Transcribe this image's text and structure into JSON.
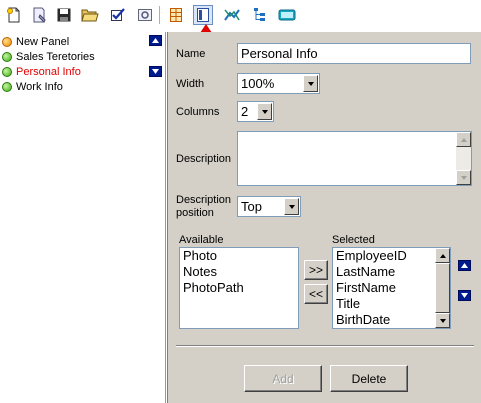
{
  "toolbar": {
    "buttons": [
      {
        "icon": "new-document-icon"
      },
      {
        "icon": "properties-icon"
      },
      {
        "icon": "save-icon"
      },
      {
        "icon": "open-folder-icon"
      },
      {
        "icon": "check-icon"
      },
      {
        "icon": "preview-icon"
      },
      {
        "icon": "table-layout-icon"
      },
      {
        "icon": "panel-icon",
        "active": true
      },
      {
        "icon": "connector-icon"
      },
      {
        "icon": "tree-icon"
      },
      {
        "icon": "keyboard-icon"
      }
    ],
    "highlight_color": "#e00000"
  },
  "tree": {
    "items": [
      {
        "label": "New Panel",
        "status": "orange"
      },
      {
        "label": "Sales Teretories",
        "status": "green"
      },
      {
        "label": "Personal Info",
        "status": "green",
        "selected": true
      },
      {
        "label": "Work Info",
        "status": "green"
      }
    ]
  },
  "form": {
    "name_label": "Name",
    "name_value": "Personal Info",
    "width_label": "Width",
    "width_value": "100%",
    "columns_label": "Columns",
    "columns_value": "2",
    "description_label": "Description",
    "description_value": "",
    "desc_position_label_1": "Description",
    "desc_position_label_2": "position",
    "desc_position_value": "Top",
    "available_label": "Available",
    "available_items": [
      "Photo",
      "Notes",
      "PhotoPath"
    ],
    "selected_label": "Selected",
    "selected_items": [
      "EmployeeID",
      "LastName",
      "FirstName",
      "Title",
      "BirthDate"
    ],
    "move_right_label": ">>",
    "move_left_label": "<<",
    "add_label": "Add",
    "delete_label": "Delete"
  }
}
